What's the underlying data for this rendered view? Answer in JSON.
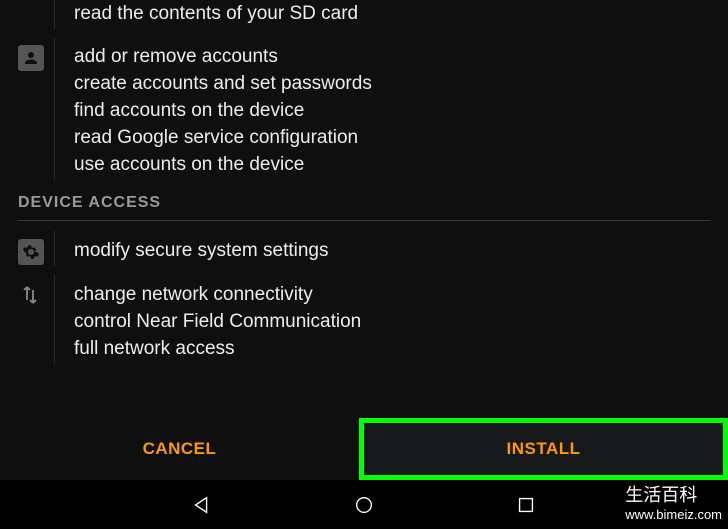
{
  "groups": [
    {
      "icon": null,
      "items": [
        "read the contents of your SD card"
      ]
    },
    {
      "icon": "person",
      "items": [
        "add or remove accounts",
        "create accounts and set passwords",
        "find accounts on the device",
        "read Google service configuration",
        "use accounts on the device"
      ]
    }
  ],
  "section_header": "DEVICE ACCESS",
  "device_groups": [
    {
      "icon": "gear",
      "items": [
        "modify secure system settings"
      ]
    },
    {
      "icon": "swap",
      "items": [
        "change network connectivity",
        "control Near Field Communication",
        "full network access"
      ]
    }
  ],
  "buttons": {
    "cancel": "CANCEL",
    "install": "INSTALL"
  },
  "watermark": {
    "title": "生活百科",
    "url": "www.bimeiz.com"
  }
}
